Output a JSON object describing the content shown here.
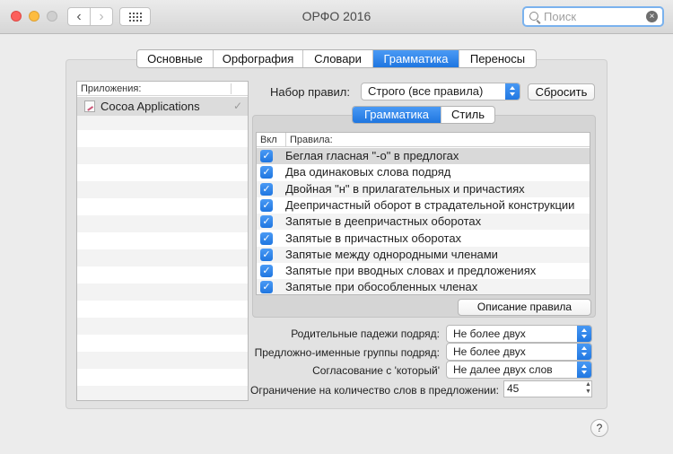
{
  "window": {
    "title": "ОРФО 2016"
  },
  "search": {
    "placeholder": "Поиск",
    "value": ""
  },
  "tabs": [
    {
      "label": "Основные",
      "active": false
    },
    {
      "label": "Орфография",
      "active": false
    },
    {
      "label": "Словари",
      "active": false
    },
    {
      "label": "Грамматика",
      "active": true
    },
    {
      "label": "Переносы",
      "active": false
    }
  ],
  "apps": {
    "header": "Приложения:",
    "items": [
      {
        "label": "Cocoa Applications",
        "checked": true
      }
    ]
  },
  "ruleset": {
    "label": "Набор правил:",
    "selected": "Строго (все правила)",
    "reset_label": "Сбросить"
  },
  "subtabs": [
    {
      "label": "Грамматика",
      "active": true
    },
    {
      "label": "Стиль",
      "active": false
    }
  ],
  "rules": {
    "col_on": "Вкл",
    "col_rule": "Правила:",
    "items": [
      {
        "label": "Беглая гласная \"-о\" в предлогах",
        "checked": true
      },
      {
        "label": "Два одинаковых слова подряд",
        "checked": true
      },
      {
        "label": "Двойная \"н\" в прилагательных и причастиях",
        "checked": true
      },
      {
        "label": "Деепричастный оборот в страдательной конструкции",
        "checked": true
      },
      {
        "label": "Запятые в деепричастных оборотах",
        "checked": true
      },
      {
        "label": "Запятые в причастных оборотах",
        "checked": true
      },
      {
        "label": "Запятые между однородными членами",
        "checked": true
      },
      {
        "label": "Запятые при вводных словах и предложениях",
        "checked": true
      },
      {
        "label": "Запятые при обособленных членах",
        "checked": true
      }
    ],
    "describe_label": "Описание правила"
  },
  "options": {
    "genitive": {
      "label": "Родительные падежи подряд:",
      "value": "Не более двух"
    },
    "prep_groups": {
      "label": "Предложно-именные группы подряд:",
      "value": "Не более двух"
    },
    "which": {
      "label": "Согласование с 'который'",
      "value": "Не далее двух слов"
    },
    "word_limit": {
      "label": "Ограничение на количество слов в предложении:",
      "value": "45"
    }
  },
  "help": {
    "label": "?"
  },
  "icons": {
    "check": "✓",
    "clear": "×",
    "back": "‹",
    "forward": "›"
  }
}
